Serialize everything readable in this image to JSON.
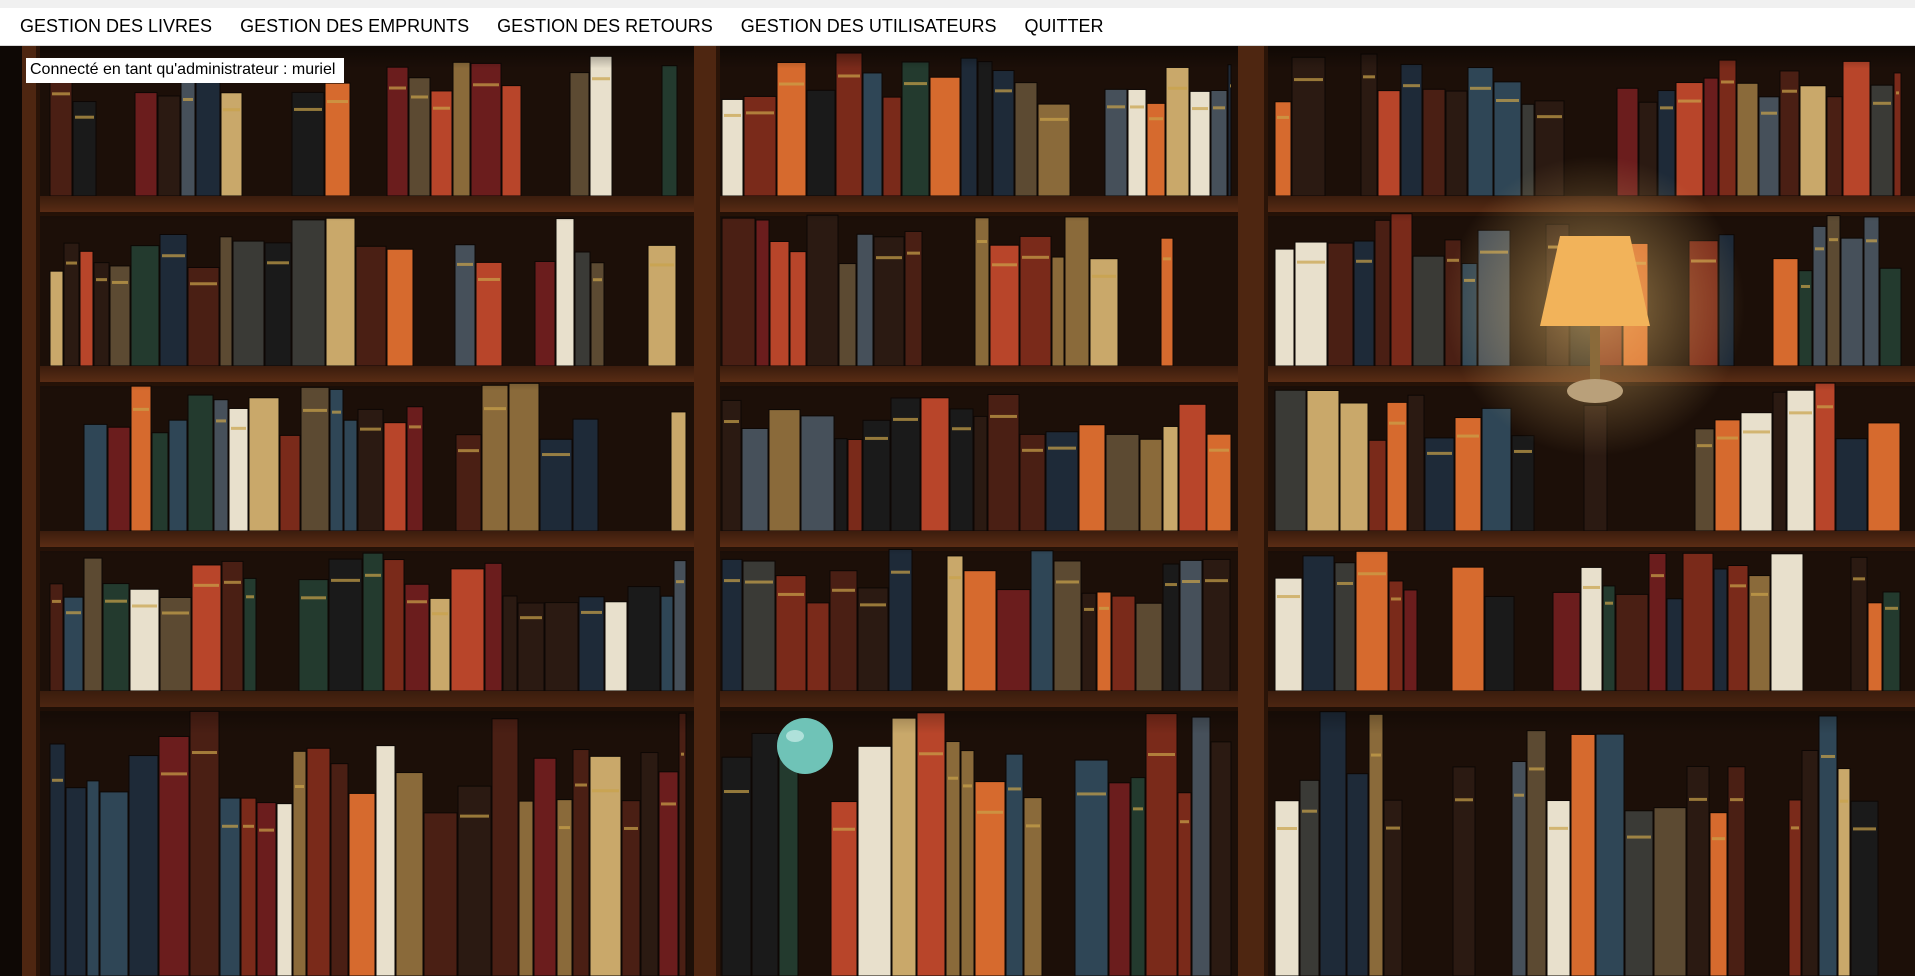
{
  "menu": {
    "items": [
      {
        "key": "books",
        "label": "GESTION DES LIVRES"
      },
      {
        "key": "loans",
        "label": "GESTION DES EMPRUNTS"
      },
      {
        "key": "returns",
        "label": "GESTION DES RETOURS"
      },
      {
        "key": "users",
        "label": "GESTION DES UTILISATEURS"
      },
      {
        "key": "quit",
        "label": "QUITTER"
      }
    ]
  },
  "status": {
    "logged_in_text": "Connecté en tant qu'administrateur : muriel"
  },
  "background": {
    "image": "bookshelf-library-photo",
    "colors": {
      "wood": "#5a2e14",
      "shadow": "#140a05",
      "lamp": "#f2b35a"
    }
  }
}
